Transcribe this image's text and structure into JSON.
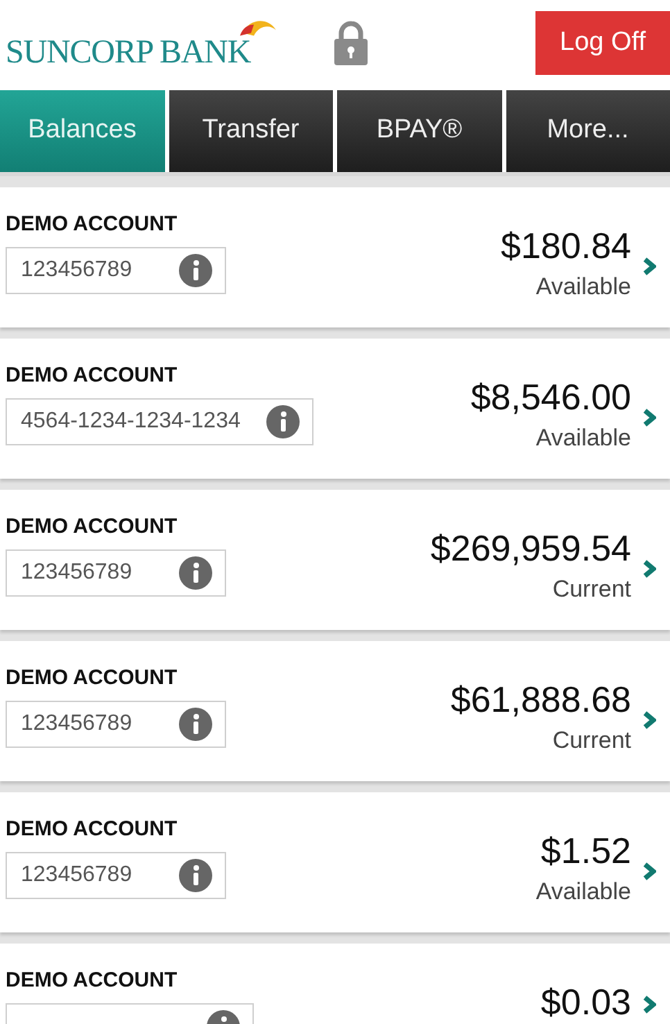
{
  "header": {
    "logo_text": "SUNCORP BANK",
    "logoff_button": "Log Off"
  },
  "tabs": [
    {
      "label": "Balances",
      "selected": true
    },
    {
      "label": "Transfer",
      "selected": false
    },
    {
      "label": "BPAY®",
      "selected": false
    },
    {
      "label": "More...",
      "selected": false
    }
  ],
  "accounts": [
    {
      "name": "DEMO ACCOUNT",
      "number": "123456789",
      "amount": "$180.84",
      "balance_type": "Available"
    },
    {
      "name": "DEMO ACCOUNT",
      "number": "4564-1234-1234-1234",
      "amount": "$8,546.00",
      "balance_type": "Available"
    },
    {
      "name": "DEMO ACCOUNT",
      "number": "123456789",
      "amount": "$269,959.54",
      "balance_type": "Current"
    },
    {
      "name": "DEMO ACCOUNT",
      "number": "123456789",
      "amount": "$61,888.68",
      "balance_type": "Current"
    },
    {
      "name": "DEMO ACCOUNT",
      "number": "123456789",
      "amount": "$1.52",
      "balance_type": "Available"
    },
    {
      "name": "DEMO ACCOUNT",
      "amount": "$0.03"
    }
  ]
}
